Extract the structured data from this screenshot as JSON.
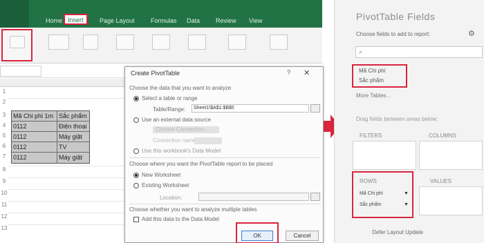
{
  "excel": {
    "ribbon": {
      "tabs": [
        "Home",
        "Insert",
        "Page Layout",
        "Formulas",
        "Data",
        "Review",
        "View"
      ]
    },
    "row_numbers": [
      "1",
      "2",
      "3",
      "4",
      "5",
      "6",
      "7",
      "8",
      "9",
      "10",
      "11",
      "12",
      "13"
    ],
    "table": {
      "headers": [
        "Mã Chi phi 1m",
        "Sắc phẩm"
      ],
      "rows": [
        [
          "0112",
          "Điện thoại"
        ],
        [
          "0112",
          "Máy giặt"
        ],
        [
          "0112",
          "TV"
        ],
        [
          "0112",
          "Máy giặt"
        ]
      ]
    }
  },
  "dialog": {
    "title": "Create PivotTable",
    "help": "?",
    "close": "✕",
    "section1": "Choose the data that you want to analyze",
    "opt_select_table": "Select a table or range",
    "table_range_label": "Table/Range:",
    "table_range_value": "Sheet1!$A$1:$B$5",
    "opt_external": "Use an external data source",
    "choose_connection": "Choose Connection...",
    "connection_name": "Connection name:",
    "opt_data_model": "Use this workbook's Data Model",
    "section2": "Choose where you want the PivotTable report to be placed",
    "opt_new_ws": "New Worksheet",
    "opt_existing_ws": "Existing Worksheet",
    "location_label": "Location:",
    "section3": "Choose whether you want to analyze multiple tables",
    "add_data_model": "Add this data to the Data Model",
    "ok": "OK",
    "cancel": "Cancel"
  },
  "pane": {
    "title": "PivotTable Fields",
    "subtitle": "Choose fields to add to report:",
    "gear_icon": "gear-icon",
    "fields": [
      "Mã Chi phí",
      "Sắc phẩm"
    ],
    "more_tables": "More Tables...",
    "drag_label": "Drag fields between areas below:",
    "areas": {
      "filters": "FILTERS",
      "columns": "COLUMNS",
      "rows": "ROWS",
      "values": "VALUES"
    },
    "row_chips": [
      "Mã Chi phí",
      "Sắc phẩm"
    ],
    "defer": "Defer Layout Update"
  },
  "colors": {
    "excel_green": "#217346",
    "highlight_red": "#d8243d"
  }
}
